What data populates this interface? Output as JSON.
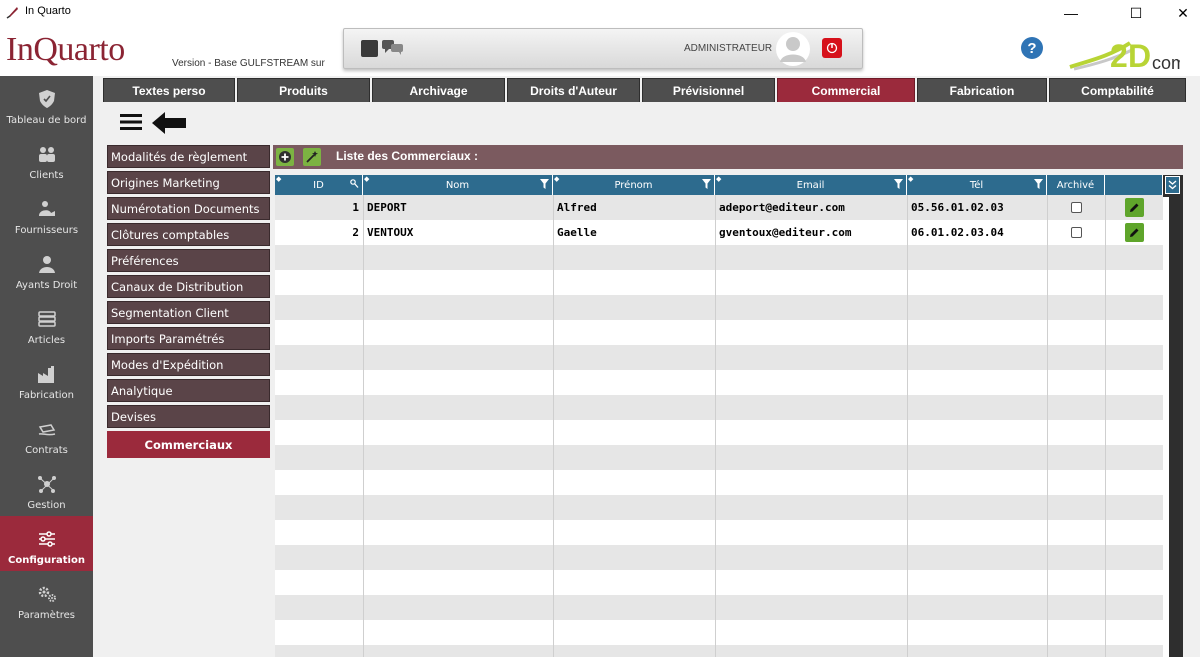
{
  "window": {
    "title": "In Quarto",
    "minimize": "—",
    "maximize": "☐",
    "close": "✕"
  },
  "header": {
    "logo": "InQuarto",
    "version": "Version  - Base GULFSTREAM sur",
    "user": "ADMINISTRATEUR",
    "help": "?",
    "brand": "2Dcom"
  },
  "sidebar": {
    "items": [
      {
        "label": "Tableau de bord",
        "icon": "shield-icon"
      },
      {
        "label": "Clients",
        "icon": "users-icon"
      },
      {
        "label": "Fournisseurs",
        "icon": "handshake-icon"
      },
      {
        "label": "Ayants Droit",
        "icon": "person-icon"
      },
      {
        "label": "Articles",
        "icon": "books-icon"
      },
      {
        "label": "Fabrication",
        "icon": "factory-icon"
      },
      {
        "label": "Contrats",
        "icon": "contract-icon"
      },
      {
        "label": "Gestion",
        "icon": "network-icon"
      },
      {
        "label": "Configuration",
        "icon": "sliders-icon",
        "active": true
      },
      {
        "label": "Paramètres",
        "icon": "gears-icon"
      }
    ]
  },
  "tabs": [
    {
      "label": "Textes perso"
    },
    {
      "label": "Produits"
    },
    {
      "label": "Archivage"
    },
    {
      "label": "Droits d'Auteur"
    },
    {
      "label": "Prévisionnel"
    },
    {
      "label": "Commercial",
      "active": true
    },
    {
      "label": "Fabrication"
    },
    {
      "label": "Comptabilité"
    }
  ],
  "submenu": [
    {
      "label": "Modalités de règlement"
    },
    {
      "label": "Origines Marketing"
    },
    {
      "label": "Numérotation Documents"
    },
    {
      "label": "Clôtures comptables"
    },
    {
      "label": "Préférences"
    },
    {
      "label": "Canaux de Distribution"
    },
    {
      "label": "Segmentation Client"
    },
    {
      "label": "Imports Paramétrés"
    },
    {
      "label": "Modes d'Expédition"
    },
    {
      "label": "Analytique"
    },
    {
      "label": "Devises"
    },
    {
      "label": "Commerciaux",
      "active": true
    }
  ],
  "list": {
    "title": "Liste des Commerciaux :",
    "columns": [
      "ID",
      "Nom",
      "Prénom",
      "Email",
      "Tél",
      "Archivé",
      ""
    ],
    "rows": [
      {
        "id": "1",
        "nom": "DEPORT",
        "prenom": "Alfred",
        "email": "adeport@editeur.com",
        "tel": "05.56.01.02.03",
        "archive": false
      },
      {
        "id": "2",
        "nom": "VENTOUX",
        "prenom": "Gaelle",
        "email": "gventoux@editeur.com",
        "tel": "06.01.02.03.04",
        "archive": false
      }
    ]
  },
  "colors": {
    "accent": "#9b2a3c",
    "nav": "#4e4e4e",
    "grid_header": "#2d6b8e",
    "submenu": "#5a4448",
    "list_header": "#7b5a5f",
    "edit": "#5fa52b"
  }
}
